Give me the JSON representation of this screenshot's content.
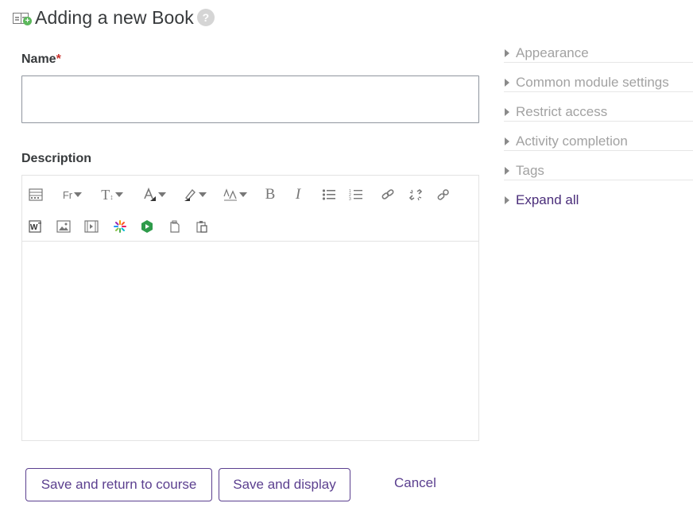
{
  "header": {
    "icon": "book-add-icon",
    "title": "Adding a new Book",
    "help_icon": "help-icon",
    "help_symbol": "?"
  },
  "form": {
    "name_label": "Name",
    "required_mark": "*",
    "name_value": "",
    "description_label": "Description"
  },
  "editor": {
    "toolbar_row1": [
      "toolbar-toggle-icon",
      "font-family-icon",
      "font-size-icon",
      "font-color-icon",
      "background-color-icon",
      "text-style-icon",
      "bold-icon",
      "italic-icon",
      "bullet-list-icon",
      "numbered-list-icon",
      "link-icon",
      "unlink-icon",
      "anchor-icon"
    ],
    "toolbar_row2": [
      "word-paste-icon",
      "image-icon",
      "media-icon",
      "h5p-icon",
      "recordrtc-icon",
      "copy-icon",
      "paste-icon"
    ],
    "font_family_glyph": "Fr",
    "font_size_glyph": "T",
    "bold_glyph": "B",
    "italic_glyph": "I",
    "content": ""
  },
  "sidebar": {
    "sections": [
      {
        "label": "Appearance"
      },
      {
        "label": "Common module settings"
      },
      {
        "label": "Restrict access"
      },
      {
        "label": "Activity completion"
      },
      {
        "label": "Tags"
      }
    ],
    "expand_all_label": "Expand all"
  },
  "actions": {
    "save_return_label": "Save and return to course",
    "save_display_label": "Save and display",
    "cancel_label": "Cancel"
  },
  "colors": {
    "accent": "#5b3f8f",
    "required": "#c9302c",
    "muted": "#a2a2a2"
  }
}
